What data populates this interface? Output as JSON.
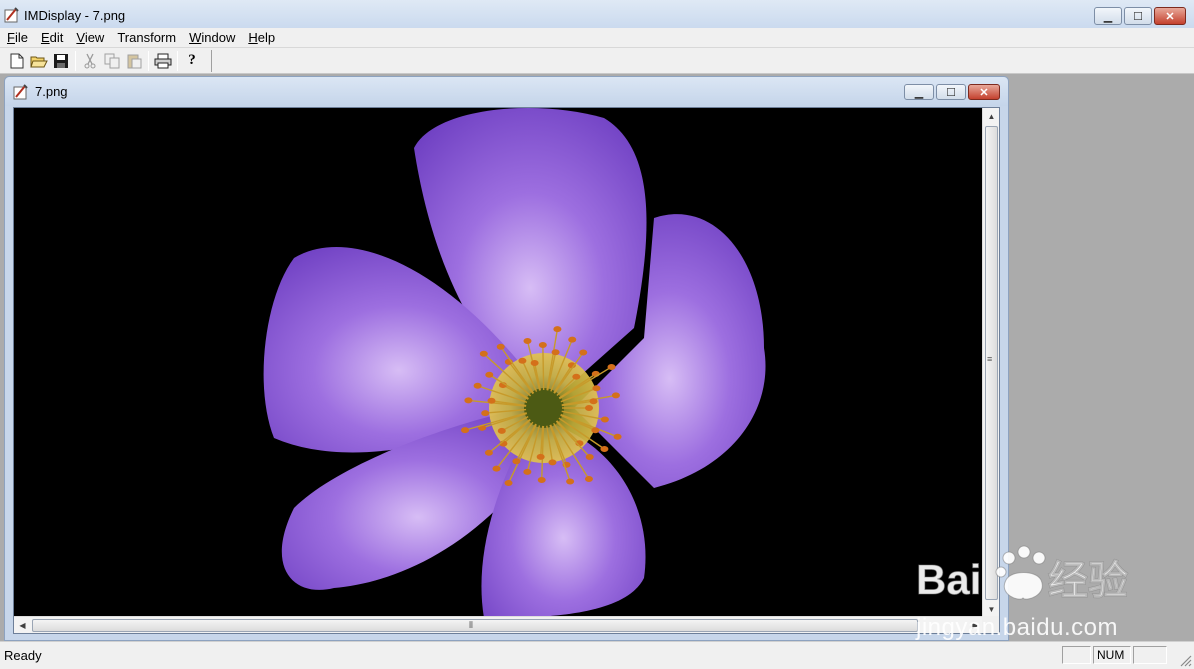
{
  "app": {
    "title": "IMDisplay - 7.png",
    "window_buttons": {
      "minimize": "▁",
      "maximize": "☐",
      "close": "✕"
    }
  },
  "menu": [
    {
      "label": "File",
      "accel": "F",
      "rest": "ile"
    },
    {
      "label": "Edit",
      "accel": "E",
      "rest": "dit"
    },
    {
      "label": "View",
      "accel": "V",
      "rest": "iew"
    },
    {
      "label": "Transform",
      "accel": "",
      "rest": "Transform"
    },
    {
      "label": "Window",
      "accel": "W",
      "rest": "indow"
    },
    {
      "label": "Help",
      "accel": "H",
      "rest": "elp"
    }
  ],
  "toolbar": {
    "icons": [
      "new-icon",
      "open-icon",
      "save-icon",
      "cut-icon",
      "copy-icon",
      "paste-icon",
      "print-icon",
      "help-icon"
    ],
    "help_glyph": "?"
  },
  "document": {
    "title": "7.png",
    "hscroll_grip": "⦀",
    "vscroll_grip": "≡"
  },
  "status": {
    "text": "Ready",
    "num": "NUM"
  },
  "watermark": {
    "text": "jingyan.baidu.com"
  },
  "colors": {
    "petal": "#8a5ad6",
    "petal_light": "#c9a6f0",
    "center": "#c7b43c",
    "stamen": "#d4701a",
    "background": "#000000"
  }
}
